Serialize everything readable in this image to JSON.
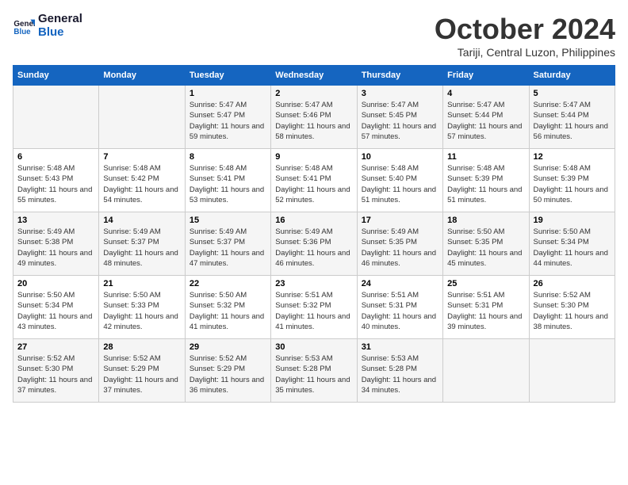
{
  "header": {
    "logo_line1": "General",
    "logo_line2": "Blue",
    "month": "October 2024",
    "location": "Tariji, Central Luzon, Philippines"
  },
  "weekdays": [
    "Sunday",
    "Monday",
    "Tuesday",
    "Wednesday",
    "Thursday",
    "Friday",
    "Saturday"
  ],
  "weeks": [
    [
      {
        "day": "",
        "sunrise": "",
        "sunset": "",
        "daylight": ""
      },
      {
        "day": "",
        "sunrise": "",
        "sunset": "",
        "daylight": ""
      },
      {
        "day": "1",
        "sunrise": "Sunrise: 5:47 AM",
        "sunset": "Sunset: 5:47 PM",
        "daylight": "Daylight: 11 hours and 59 minutes."
      },
      {
        "day": "2",
        "sunrise": "Sunrise: 5:47 AM",
        "sunset": "Sunset: 5:46 PM",
        "daylight": "Daylight: 11 hours and 58 minutes."
      },
      {
        "day": "3",
        "sunrise": "Sunrise: 5:47 AM",
        "sunset": "Sunset: 5:45 PM",
        "daylight": "Daylight: 11 hours and 57 minutes."
      },
      {
        "day": "4",
        "sunrise": "Sunrise: 5:47 AM",
        "sunset": "Sunset: 5:44 PM",
        "daylight": "Daylight: 11 hours and 57 minutes."
      },
      {
        "day": "5",
        "sunrise": "Sunrise: 5:47 AM",
        "sunset": "Sunset: 5:44 PM",
        "daylight": "Daylight: 11 hours and 56 minutes."
      }
    ],
    [
      {
        "day": "6",
        "sunrise": "Sunrise: 5:48 AM",
        "sunset": "Sunset: 5:43 PM",
        "daylight": "Daylight: 11 hours and 55 minutes."
      },
      {
        "day": "7",
        "sunrise": "Sunrise: 5:48 AM",
        "sunset": "Sunset: 5:42 PM",
        "daylight": "Daylight: 11 hours and 54 minutes."
      },
      {
        "day": "8",
        "sunrise": "Sunrise: 5:48 AM",
        "sunset": "Sunset: 5:41 PM",
        "daylight": "Daylight: 11 hours and 53 minutes."
      },
      {
        "day": "9",
        "sunrise": "Sunrise: 5:48 AM",
        "sunset": "Sunset: 5:41 PM",
        "daylight": "Daylight: 11 hours and 52 minutes."
      },
      {
        "day": "10",
        "sunrise": "Sunrise: 5:48 AM",
        "sunset": "Sunset: 5:40 PM",
        "daylight": "Daylight: 11 hours and 51 minutes."
      },
      {
        "day": "11",
        "sunrise": "Sunrise: 5:48 AM",
        "sunset": "Sunset: 5:39 PM",
        "daylight": "Daylight: 11 hours and 51 minutes."
      },
      {
        "day": "12",
        "sunrise": "Sunrise: 5:48 AM",
        "sunset": "Sunset: 5:39 PM",
        "daylight": "Daylight: 11 hours and 50 minutes."
      }
    ],
    [
      {
        "day": "13",
        "sunrise": "Sunrise: 5:49 AM",
        "sunset": "Sunset: 5:38 PM",
        "daylight": "Daylight: 11 hours and 49 minutes."
      },
      {
        "day": "14",
        "sunrise": "Sunrise: 5:49 AM",
        "sunset": "Sunset: 5:37 PM",
        "daylight": "Daylight: 11 hours and 48 minutes."
      },
      {
        "day": "15",
        "sunrise": "Sunrise: 5:49 AM",
        "sunset": "Sunset: 5:37 PM",
        "daylight": "Daylight: 11 hours and 47 minutes."
      },
      {
        "day": "16",
        "sunrise": "Sunrise: 5:49 AM",
        "sunset": "Sunset: 5:36 PM",
        "daylight": "Daylight: 11 hours and 46 minutes."
      },
      {
        "day": "17",
        "sunrise": "Sunrise: 5:49 AM",
        "sunset": "Sunset: 5:35 PM",
        "daylight": "Daylight: 11 hours and 46 minutes."
      },
      {
        "day": "18",
        "sunrise": "Sunrise: 5:50 AM",
        "sunset": "Sunset: 5:35 PM",
        "daylight": "Daylight: 11 hours and 45 minutes."
      },
      {
        "day": "19",
        "sunrise": "Sunrise: 5:50 AM",
        "sunset": "Sunset: 5:34 PM",
        "daylight": "Daylight: 11 hours and 44 minutes."
      }
    ],
    [
      {
        "day": "20",
        "sunrise": "Sunrise: 5:50 AM",
        "sunset": "Sunset: 5:34 PM",
        "daylight": "Daylight: 11 hours and 43 minutes."
      },
      {
        "day": "21",
        "sunrise": "Sunrise: 5:50 AM",
        "sunset": "Sunset: 5:33 PM",
        "daylight": "Daylight: 11 hours and 42 minutes."
      },
      {
        "day": "22",
        "sunrise": "Sunrise: 5:50 AM",
        "sunset": "Sunset: 5:32 PM",
        "daylight": "Daylight: 11 hours and 41 minutes."
      },
      {
        "day": "23",
        "sunrise": "Sunrise: 5:51 AM",
        "sunset": "Sunset: 5:32 PM",
        "daylight": "Daylight: 11 hours and 41 minutes."
      },
      {
        "day": "24",
        "sunrise": "Sunrise: 5:51 AM",
        "sunset": "Sunset: 5:31 PM",
        "daylight": "Daylight: 11 hours and 40 minutes."
      },
      {
        "day": "25",
        "sunrise": "Sunrise: 5:51 AM",
        "sunset": "Sunset: 5:31 PM",
        "daylight": "Daylight: 11 hours and 39 minutes."
      },
      {
        "day": "26",
        "sunrise": "Sunrise: 5:52 AM",
        "sunset": "Sunset: 5:30 PM",
        "daylight": "Daylight: 11 hours and 38 minutes."
      }
    ],
    [
      {
        "day": "27",
        "sunrise": "Sunrise: 5:52 AM",
        "sunset": "Sunset: 5:30 PM",
        "daylight": "Daylight: 11 hours and 37 minutes."
      },
      {
        "day": "28",
        "sunrise": "Sunrise: 5:52 AM",
        "sunset": "Sunset: 5:29 PM",
        "daylight": "Daylight: 11 hours and 37 minutes."
      },
      {
        "day": "29",
        "sunrise": "Sunrise: 5:52 AM",
        "sunset": "Sunset: 5:29 PM",
        "daylight": "Daylight: 11 hours and 36 minutes."
      },
      {
        "day": "30",
        "sunrise": "Sunrise: 5:53 AM",
        "sunset": "Sunset: 5:28 PM",
        "daylight": "Daylight: 11 hours and 35 minutes."
      },
      {
        "day": "31",
        "sunrise": "Sunrise: 5:53 AM",
        "sunset": "Sunset: 5:28 PM",
        "daylight": "Daylight: 11 hours and 34 minutes."
      },
      {
        "day": "",
        "sunrise": "",
        "sunset": "",
        "daylight": ""
      },
      {
        "day": "",
        "sunrise": "",
        "sunset": "",
        "daylight": ""
      }
    ]
  ]
}
